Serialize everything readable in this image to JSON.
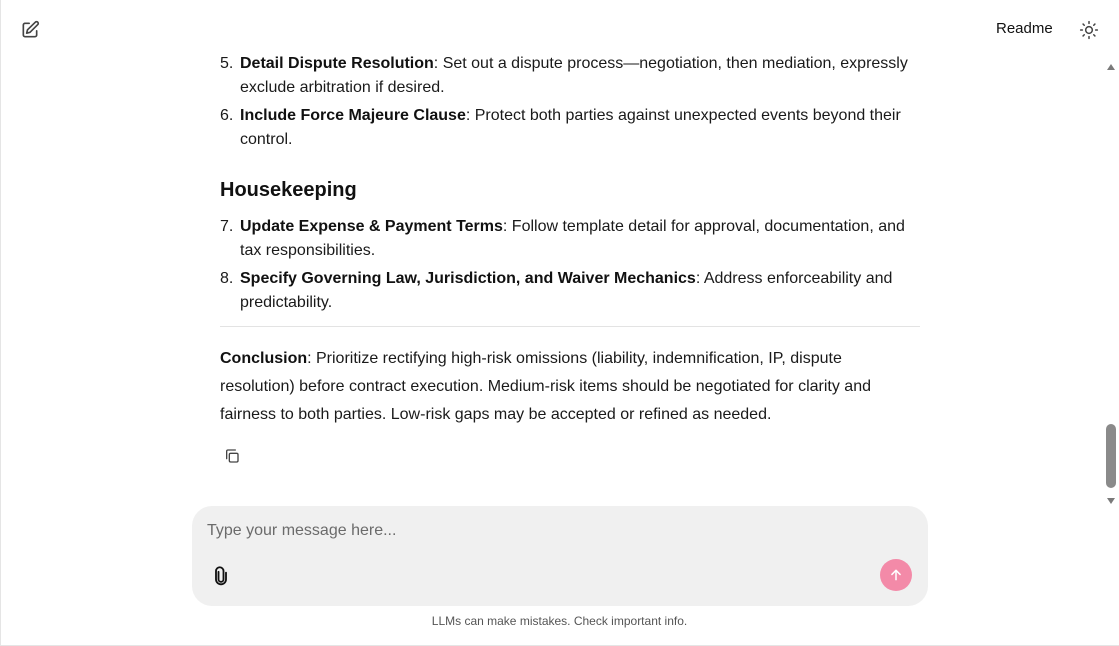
{
  "header": {
    "new_chat_icon": "edit-square-icon",
    "readme_label": "Readme",
    "theme_icon": "sun-icon"
  },
  "content": {
    "items_a": [
      {
        "num": "5.",
        "title": "Detail Dispute Resolution",
        "text": ": Set out a dispute process—negotiation, then mediation, expressly exclude arbitration if desired."
      },
      {
        "num": "6.",
        "title": "Include Force Majeure Clause",
        "text": ": Protect both parties against unexpected events beyond their control."
      }
    ],
    "heading": "Housekeeping",
    "items_b": [
      {
        "num": "7.",
        "title": "Update Expense & Payment Terms",
        "text": ": Follow template detail for approval, documentation, and tax responsibilities."
      },
      {
        "num": "8.",
        "title": "Specify Governing Law, Jurisdiction, and Waiver Mechanics",
        "text": ": Address enforceability and predictability."
      }
    ],
    "conclusion_label": "Conclusion",
    "conclusion_text": ": Prioritize rectifying high-risk omissions (liability, indemnification, IP, dispute resolution) before contract execution. Medium-risk items should be negotiated for clarity and fairness to both parties. Low-risk gaps may be accepted or refined as needed."
  },
  "composer": {
    "placeholder": "Type your message here...",
    "value": "",
    "attach_icon": "paperclip-icon",
    "send_icon": "arrow-up-icon",
    "send_color": "#f38aa8"
  },
  "footer": {
    "disclaimer": "LLMs can make mistakes. Check important info."
  }
}
